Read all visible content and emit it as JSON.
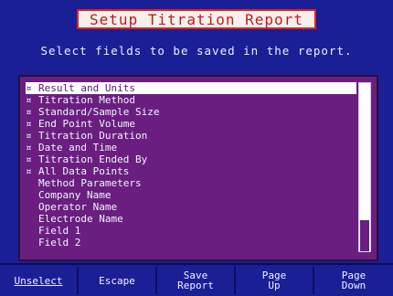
{
  "title": "Setup Titration Report",
  "subtitle": "Select fields to be saved in the report.",
  "fields": [
    {
      "label": "Result and Units",
      "checked": true,
      "selected": true
    },
    {
      "label": "Titration Method",
      "checked": true,
      "selected": false
    },
    {
      "label": "Standard/Sample Size",
      "checked": true,
      "selected": false
    },
    {
      "label": "End Point Volume",
      "checked": true,
      "selected": false
    },
    {
      "label": "Titration Duration",
      "checked": true,
      "selected": false
    },
    {
      "label": "Date and Time",
      "checked": true,
      "selected": false
    },
    {
      "label": "Titration Ended By",
      "checked": true,
      "selected": false
    },
    {
      "label": "All Data Points",
      "checked": true,
      "selected": false
    },
    {
      "label": "Method Parameters",
      "checked": false,
      "selected": false
    },
    {
      "label": "Company Name",
      "checked": false,
      "selected": false
    },
    {
      "label": "Operator Name",
      "checked": false,
      "selected": false
    },
    {
      "label": "Electrode Name",
      "checked": false,
      "selected": false
    },
    {
      "label": "Field 1",
      "checked": false,
      "selected": false
    },
    {
      "label": "Field 2",
      "checked": false,
      "selected": false
    }
  ],
  "check_mark": "¤",
  "softkeys": [
    {
      "label": "Unselect",
      "line2": ""
    },
    {
      "label": "Escape",
      "line2": ""
    },
    {
      "label": "Save",
      "line2": "Report"
    },
    {
      "label": "Page",
      "line2": "Up"
    },
    {
      "label": "Page",
      "line2": "Down"
    }
  ],
  "colors": {
    "background": "#1b1f95",
    "list_background": "#6a1f80",
    "title_text": "#c21a1a",
    "title_background": "#f6f0ea",
    "selection_background": "#ffffff"
  }
}
